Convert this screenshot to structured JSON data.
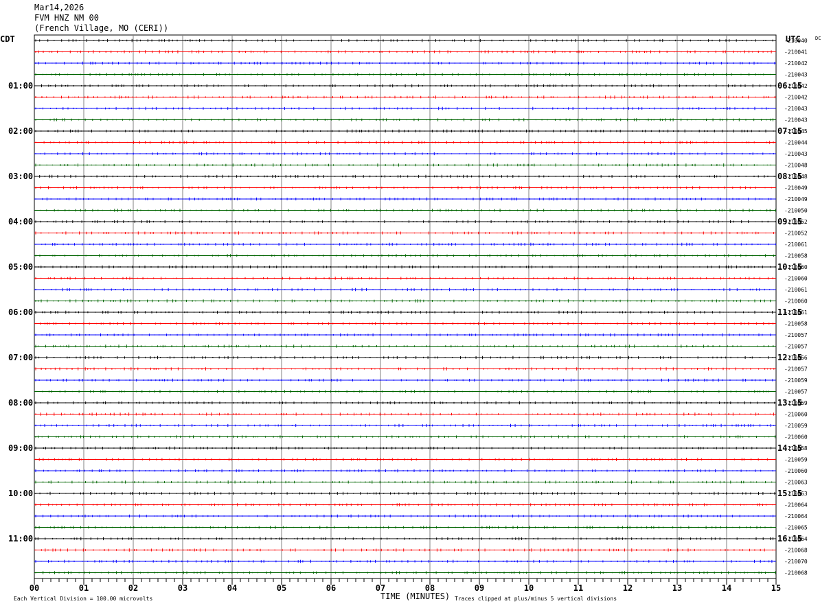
{
  "header": {
    "date": "Mar14,2026",
    "station": "FVM HNZ NM 00",
    "location": "(French Village, MO (CERI))",
    "left_timezone": "CDT",
    "right_timezone": "UTC",
    "dc_label": "DC"
  },
  "footer": {
    "scale_note": "Each Vertical Division =  100.00 microvolts",
    "xlabel": "TIME (MINUTES)",
    "clip_note": "Traces clipped at plus/minus 5 vertical divisions"
  },
  "chart_data": {
    "type": "line",
    "title": "FVM HNZ NM 00",
    "xlabel": "TIME (MINUTES)",
    "xlim": [
      0,
      15
    ],
    "x_ticks": [
      "00",
      "01",
      "02",
      "03",
      "04",
      "05",
      "06",
      "07",
      "08",
      "09",
      "10",
      "11",
      "12",
      "13",
      "14",
      "15"
    ],
    "trace_colors": [
      "#000000",
      "#ff0000",
      "#0000ff",
      "#006400"
    ],
    "rows_per_hour": 4,
    "row_count": 48,
    "left_hour_labels": [
      "01:00",
      "02:00",
      "03:00",
      "04:00",
      "05:00",
      "06:00",
      "07:00",
      "08:00",
      "09:00",
      "10:00",
      "11:00"
    ],
    "right_hour_labels": [
      "06:15",
      "07:15",
      "08:15",
      "09:15",
      "10:15",
      "11:15",
      "12:15",
      "13:15",
      "14:15",
      "15:15",
      "16:15"
    ],
    "dc_offsets": [
      "-210040",
      "-210041",
      "-210042",
      "-210043",
      "-210042",
      "-210042",
      "-210043",
      "-210043",
      "-210045",
      "-210044",
      "-210043",
      "-210048",
      "-210048",
      "-210049",
      "-210049",
      "-210050",
      "-210052",
      "-210052",
      "-210061",
      "-210058",
      "-210060",
      "-210060",
      "-210061",
      "-210060",
      "-210061",
      "-210058",
      "-210057",
      "-210057",
      "-210056",
      "-210057",
      "-210059",
      "-210057",
      "-210059",
      "-210060",
      "-210059",
      "-210060",
      "-210058",
      "-210059",
      "-210060",
      "-210063",
      "-210063",
      "-210064",
      "-210064",
      "-210065",
      "-210064",
      "-210068",
      "-210070",
      "-210068"
    ]
  }
}
